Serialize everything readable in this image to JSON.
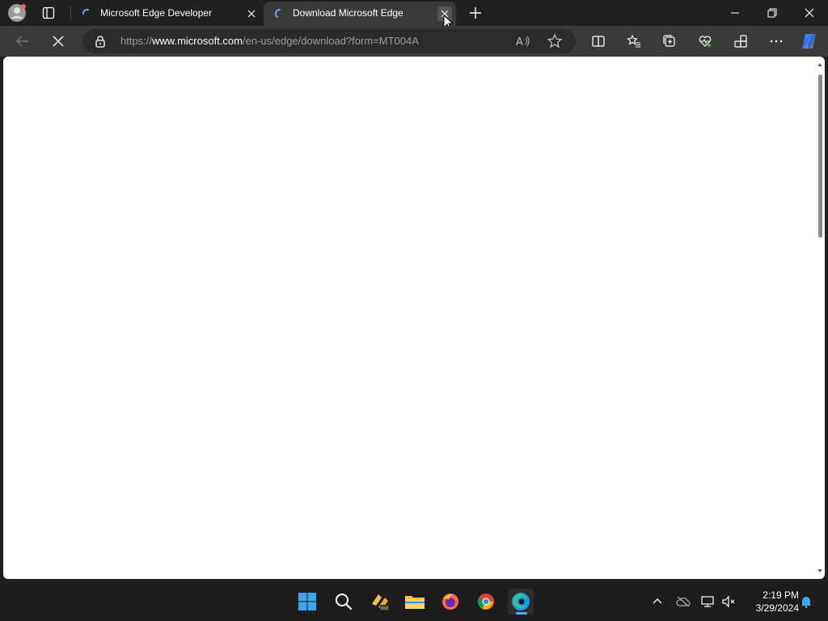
{
  "browser": {
    "tabs": [
      {
        "title": "Microsoft Edge Developer",
        "state": "loading"
      },
      {
        "title": "Download Microsoft Edge",
        "state": "loading",
        "active": true
      }
    ],
    "address": {
      "scheme": "https://",
      "host": "www.microsoft.com",
      "path": "/en-us/edge/download?form=MT004A"
    },
    "page": {
      "content": ""
    }
  },
  "taskbar": {
    "apps": [
      "start-icon",
      "search-icon",
      "file-explorer-preview-icon",
      "folder-icon",
      "firefox-icon",
      "chrome-icon",
      "edge-icon"
    ],
    "clock": {
      "time": "2:19 PM",
      "date": "3/29/2024"
    }
  },
  "colors": {
    "tabstrip": "#202020",
    "toolbar": "#3a3a3a",
    "accent": "#5aa6ff"
  }
}
